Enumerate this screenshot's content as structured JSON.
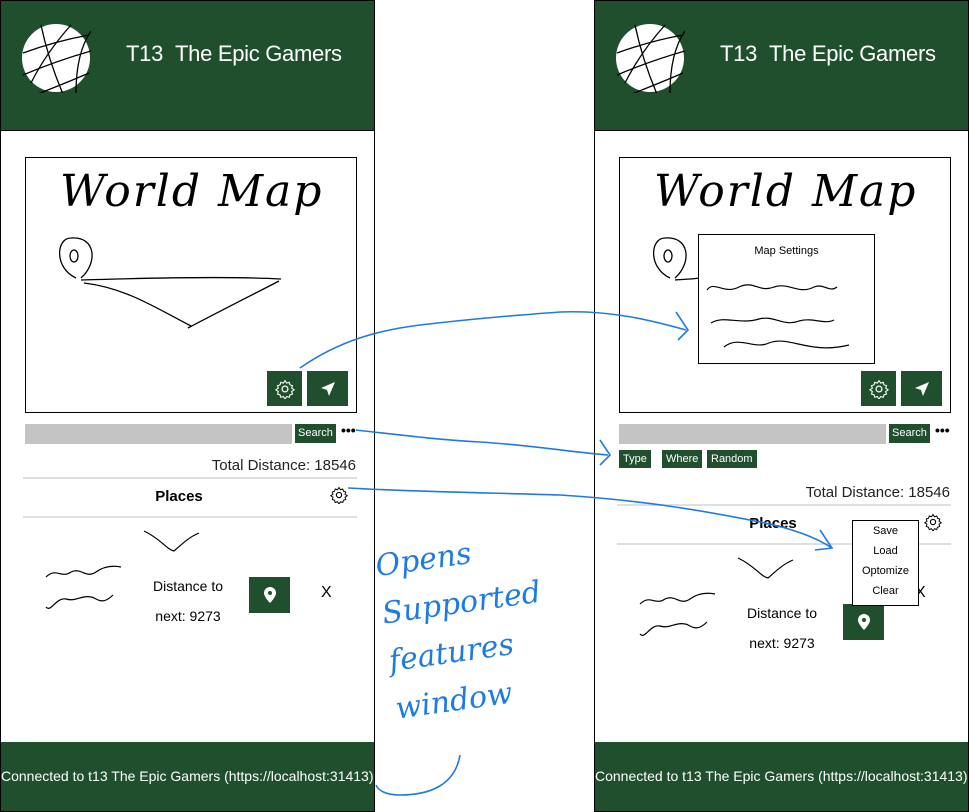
{
  "header": {
    "team": "T13",
    "name": "The Epic Gamers",
    "logo_icon": "globe-icon"
  },
  "map": {
    "title": "World Map",
    "settings_icon": "gear-icon",
    "locate_icon": "navigation-arrow-icon"
  },
  "search": {
    "button": "Search",
    "more": "•••",
    "filters": [
      "Type",
      "Where",
      "Random"
    ]
  },
  "trip": {
    "total_distance": "Total Distance: 18546",
    "places_label": "Places",
    "distance_line1": "Distance to",
    "distance_line2": "next: 9273",
    "remove": "X"
  },
  "settings_popup": {
    "title": "Map Settings"
  },
  "places_menu": [
    "Save",
    "Load",
    "Optomize",
    "Clear"
  ],
  "footer": {
    "text": "Connected to t13 The Epic Gamers (https://localhost:31413)."
  },
  "annotation": [
    "Opens",
    "Supported",
    "features",
    "window"
  ],
  "colors": {
    "brand": "#1f4f2d",
    "annotation": "#1e7be0",
    "search_bar": "#c4c4c4"
  }
}
